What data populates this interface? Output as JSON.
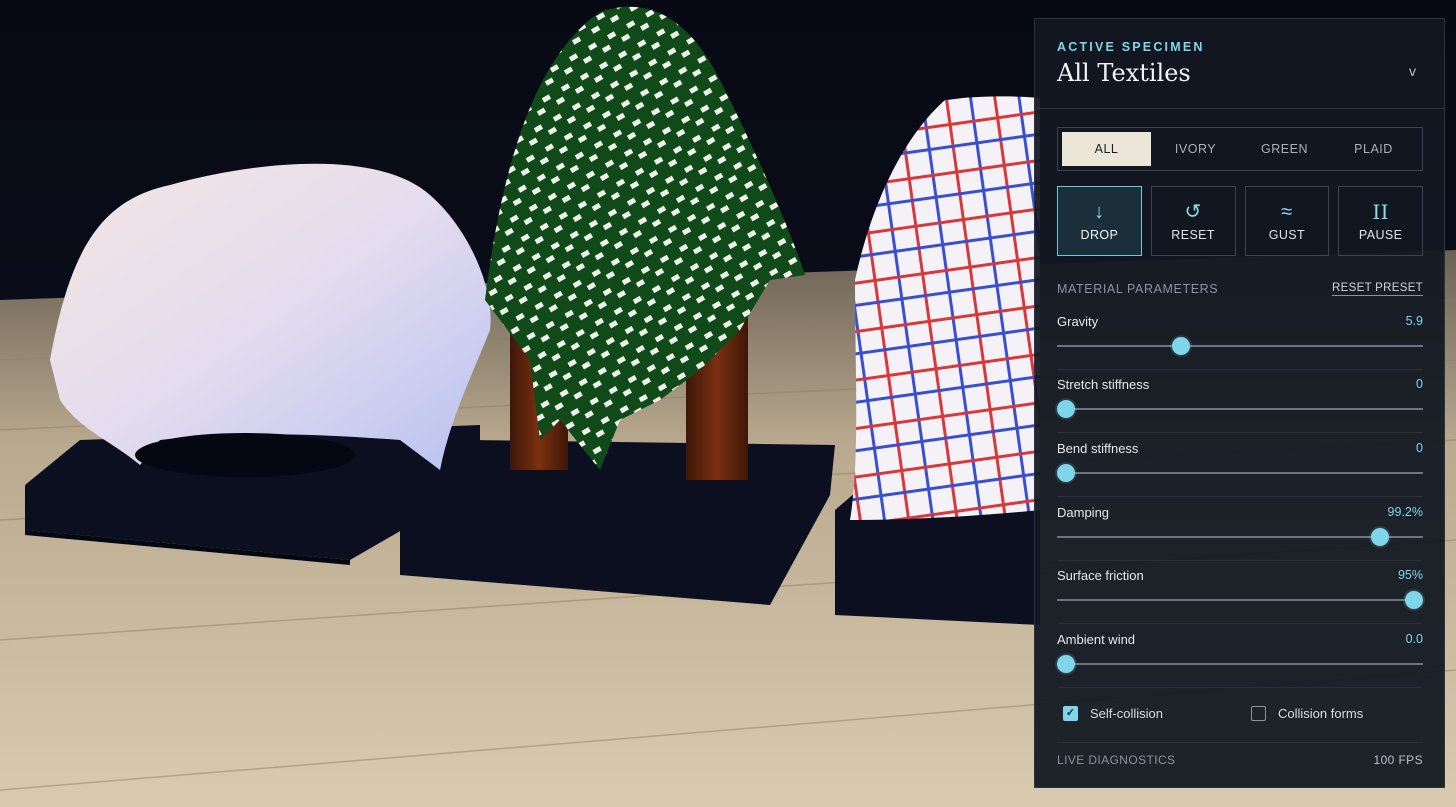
{
  "panel": {
    "header_label": "ACTIVE SPECIMEN",
    "title": "All Textiles",
    "chevron": "v"
  },
  "tabs": [
    {
      "label": "ALL",
      "active": true
    },
    {
      "label": "IVORY",
      "active": false
    },
    {
      "label": "GREEN",
      "active": false
    },
    {
      "label": "PLAID",
      "active": false
    }
  ],
  "actions": [
    {
      "label": "DROP",
      "icon": "↓",
      "icon_name": "drop-arrow-icon",
      "active": true
    },
    {
      "label": "RESET",
      "icon": "↺",
      "icon_name": "reset-icon",
      "active": false
    },
    {
      "label": "GUST",
      "icon": "≈",
      "icon_name": "gust-wave-icon",
      "active": false
    },
    {
      "label": "PAUSE",
      "icon": "II",
      "icon_name": "pause-icon",
      "active": false
    }
  ],
  "parameters": {
    "section_title": "MATERIAL PARAMETERS",
    "reset_label": "RESET PRESET",
    "items": [
      {
        "label": "Gravity",
        "value": "5.9",
        "fraction": 0.34
      },
      {
        "label": "Stretch stiffness",
        "value": "0",
        "fraction": 0.025
      },
      {
        "label": "Bend stiffness",
        "value": "0",
        "fraction": 0.025
      },
      {
        "label": "Damping",
        "value": "99.2%",
        "fraction": 0.882
      },
      {
        "label": "Surface friction",
        "value": "95%",
        "fraction": 0.975
      },
      {
        "label": "Ambient wind",
        "value": "0.0",
        "fraction": 0.025
      }
    ]
  },
  "toggles": {
    "self_collision": {
      "label": "Self-collision",
      "checked": true
    },
    "collision_forms": {
      "label": "Collision forms",
      "checked": false
    }
  },
  "diagnostics": {
    "label": "LIVE DIAGNOSTICS",
    "fps": "100 FPS"
  },
  "colors": {
    "accent": "#7fd6ea",
    "panel_bg": "#121721",
    "tab_active_bg": "#ece6d8"
  }
}
